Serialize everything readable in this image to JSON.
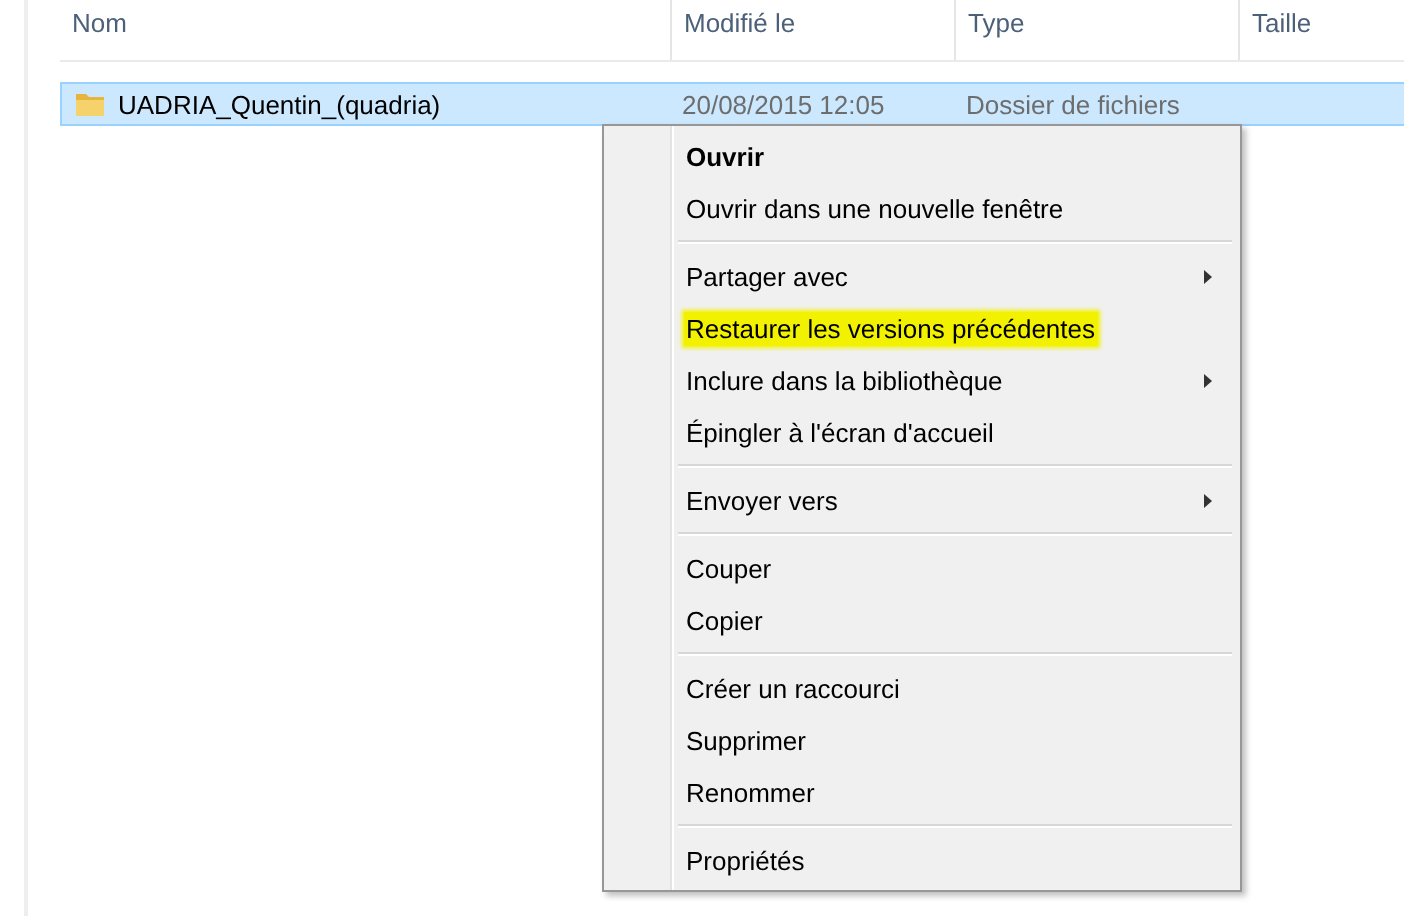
{
  "columns": [
    {
      "label": "Nom"
    },
    {
      "label": "Modifié le"
    },
    {
      "label": "Type"
    },
    {
      "label": "Taille"
    }
  ],
  "rows": [
    {
      "name": "UADRIA_Quentin_(quadria)",
      "modified": "20/08/2015 12:05",
      "type": "Dossier de fichiers",
      "selected": true
    }
  ],
  "context_menu": {
    "groups": [
      {
        "items": [
          {
            "label": "Ouvrir",
            "default": true,
            "submenu": false,
            "highlighted": false
          },
          {
            "label": "Ouvrir dans une nouvelle fenêtre",
            "default": false,
            "submenu": false,
            "highlighted": false
          }
        ]
      },
      {
        "items": [
          {
            "label": "Partager avec",
            "default": false,
            "submenu": true,
            "highlighted": false
          },
          {
            "label": "Restaurer les versions précédentes",
            "default": false,
            "submenu": false,
            "highlighted": true
          },
          {
            "label": "Inclure dans la bibliothèque",
            "default": false,
            "submenu": true,
            "highlighted": false
          },
          {
            "label": "Épingler à l'écran d'accueil",
            "default": false,
            "submenu": false,
            "highlighted": false
          }
        ]
      },
      {
        "items": [
          {
            "label": "Envoyer vers",
            "default": false,
            "submenu": true,
            "highlighted": false
          }
        ]
      },
      {
        "items": [
          {
            "label": "Couper",
            "default": false,
            "submenu": false,
            "highlighted": false
          },
          {
            "label": "Copier",
            "default": false,
            "submenu": false,
            "highlighted": false
          }
        ]
      },
      {
        "items": [
          {
            "label": "Créer un raccourci",
            "default": false,
            "submenu": false,
            "highlighted": false
          },
          {
            "label": "Supprimer",
            "default": false,
            "submenu": false,
            "highlighted": false
          },
          {
            "label": "Renommer",
            "default": false,
            "submenu": false,
            "highlighted": false
          }
        ]
      },
      {
        "items": [
          {
            "label": "Propriétés",
            "default": false,
            "submenu": false,
            "highlighted": false
          }
        ]
      }
    ]
  }
}
